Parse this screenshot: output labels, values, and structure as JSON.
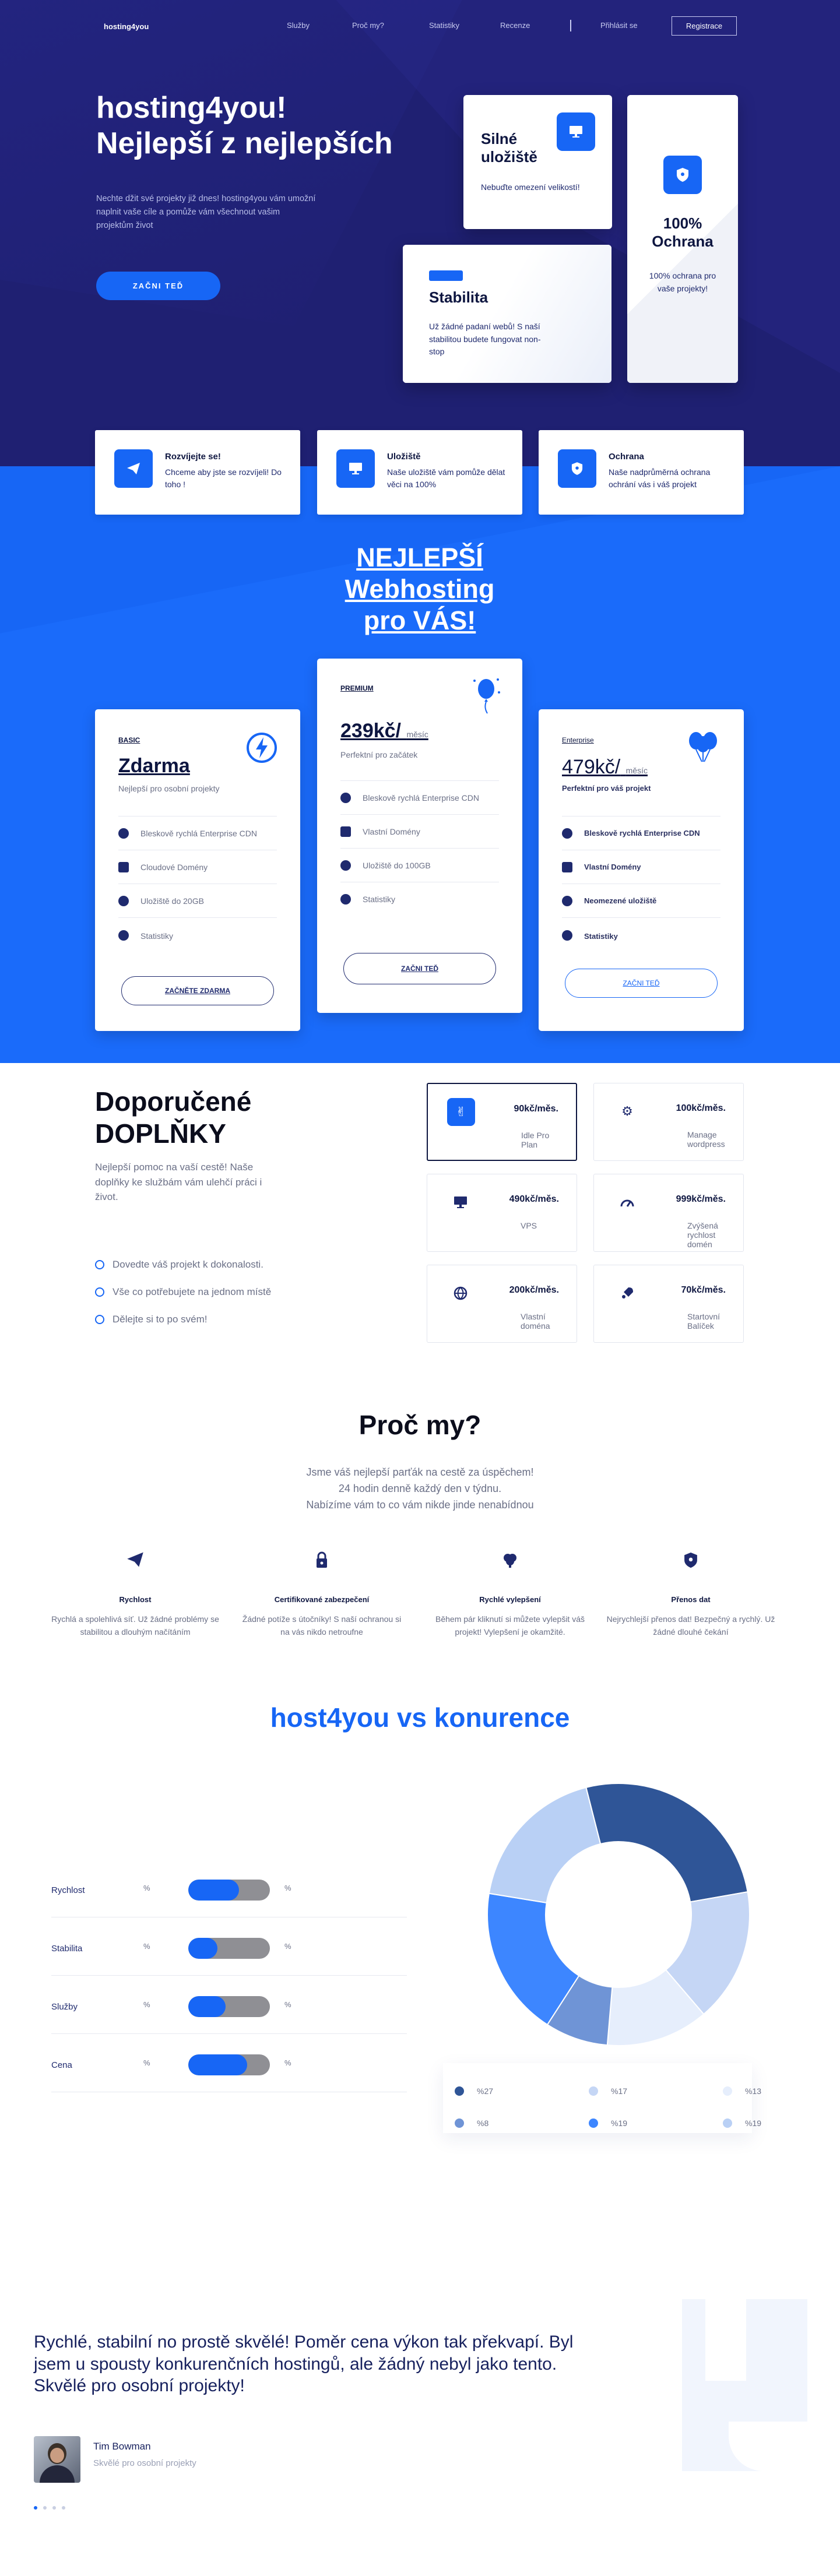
{
  "nav": {
    "logo": "hosting4you",
    "links": [
      "Služby",
      "Proč my?",
      "Statistiky",
      "Recenze"
    ],
    "login": "Přihlásit se",
    "register": "Registrace"
  },
  "hero": {
    "title_line1": "hosting4you!",
    "title_line2": "Nejlepší z nejlepších",
    "text": "Nechte džit své projekty již dnes! hosting4you vám umožní naplnit vaše cíle a pomůže vám všechnout vašim projektům život",
    "cta": "ZAČNI TEĎ",
    "cards": [
      {
        "title_line1": "Silné",
        "title_line2": "uložiště",
        "text": "Nebuďte omezení velikostí!",
        "icon": "monitor-icon"
      },
      {
        "title": "Stabilita",
        "text": "Už žádné padaní webů! S naší stabilitou budete fungovat non-stop"
      },
      {
        "title_line1": "100%",
        "title_line2": "Ochrana",
        "text": "100% ochrana pro vaše projekty!",
        "icon": "shield-icon"
      }
    ]
  },
  "features": [
    {
      "title": "Rozvíjejte se!",
      "text": "Chceme aby jste se rozvíjeli! Do toho !",
      "icon": "paper-plane-icon"
    },
    {
      "title": "Uložiště",
      "text": "Naše uložiště vám pomůže dělat věci na 100%",
      "icon": "monitor-icon"
    },
    {
      "title": "Ochrana",
      "text": "Naše nadprůměrná ochrana ochrání vás i váš projekt",
      "icon": "shield-icon"
    }
  ],
  "pricing": {
    "title_line1": "NEJLEPŠÍ",
    "title_line2": "Webhosting",
    "title_line3": "pro VÁS!",
    "plans": [
      {
        "label": "BASIC",
        "price": "Zdarma",
        "per": "",
        "desc": "Nejlepší pro osobní projekty",
        "features": [
          "Bleskově rychlá Enterprise CDN",
          "Cloudové Domény",
          "Uložiště do 20GB",
          "Statistiky"
        ],
        "button": "ZAČNĚTE ZDARMA"
      },
      {
        "label": "PREMIUM",
        "price": "239kč/",
        "per": "měsíc",
        "desc": "Perfektní pro začátek",
        "features": [
          "Bleskově rychlá Enterprise CDN",
          "Vlastní Domény",
          "Uložiště do 100GB",
          "Statistiky"
        ],
        "button": "ZAČNI TEĎ"
      },
      {
        "label": "Enterprise",
        "price": "479kč/",
        "per": "měsíc",
        "desc": "Perfektní pro váš projekt",
        "features": [
          "Bleskově rychlá Enterprise CDN",
          "Vlastní Domény",
          "Neomezené uložiště",
          "Statistiky"
        ],
        "button": "ZAČNI TEĎ"
      }
    ]
  },
  "addons": {
    "title_line1": "Doporučené",
    "title_line2": "DOPLŇKY",
    "text": "Nejlepší pomoc na vaší cestě! Naše doplňky ke službám vám ulehčí práci i život.",
    "checks": [
      "Dovedte váš projekt k dokonalosti.",
      "Vše co potřebujete na jednom místě",
      "Dělejte si to po svém!"
    ],
    "items": [
      {
        "price": "90kč/měs.",
        "name": "Idle Pro Plan",
        "icon": "handshake-icon"
      },
      {
        "price": "100kč/měs.",
        "name": "Manage wordpress",
        "icon": "gear-icon"
      },
      {
        "price": "490kč/měs.",
        "name": "VPS",
        "icon": "monitor-icon"
      },
      {
        "price": "999kč/měs.",
        "name": "Zvýšená rychlost domén",
        "icon": "speedometer-icon"
      },
      {
        "price": "200kč/měs.",
        "name": "Vlastní doména",
        "icon": "globe-icon"
      },
      {
        "price": "70kč/měs.",
        "name": "Startovní Balíček",
        "icon": "rocket-icon"
      }
    ]
  },
  "why": {
    "title": "Proč my?",
    "text_line1": "Jsme váš nejlepší parťák na cestě za úspěchem!",
    "text_line2": "24 hodin denně každý den v týdnu.",
    "text_line3": "Nabízíme vám to co vám nikde jinde nenabídnou",
    "items": [
      {
        "title": "Rychlost",
        "text": "Rychlá a spolehlivá síť. Už žádné problémy se stabilitou a dlouhým načítáním",
        "icon": "paper-plane-icon"
      },
      {
        "title": "Certifikované zabezpečení",
        "text": "Žádné potíže s útočníky! S naší ochranou si na vás nikdo netroufne",
        "icon": "lock-icon"
      },
      {
        "title": "Rychlé vylepšení",
        "text": "Během pár kliknutí si můžete vylepšit váš projekt! Vylepšení je okamžité.",
        "icon": "brain-icon"
      },
      {
        "title": "Přenos dat",
        "text": "Nejrychlejší přenos dat! Bezpečný a rychlý. Už žádné dlouhé čekání",
        "icon": "shield-icon"
      }
    ]
  },
  "compare": {
    "title": "host4you vs konurence",
    "bars": [
      {
        "label": "Rychlost",
        "left": "%",
        "right": "%",
        "fill": 0.62
      },
      {
        "label": "Stabilita",
        "left": "%",
        "right": "%",
        "fill": 0.36
      },
      {
        "label": "Služby",
        "left": "%",
        "right": "%",
        "fill": 0.46
      },
      {
        "label": "Cena",
        "left": "%",
        "right": "%",
        "fill": 0.72
      }
    ]
  },
  "chart_data": {
    "type": "pie",
    "slices": [
      {
        "label": "%27",
        "value": 27,
        "color": "#2f5597"
      },
      {
        "label": "%17",
        "value": 17,
        "color": "#c5d6f5"
      },
      {
        "label": "%13",
        "value": 13,
        "color": "#e6eefc"
      },
      {
        "label": "%8",
        "value": 8,
        "color": "#6f94d6"
      },
      {
        "label": "%19",
        "value": 19,
        "color": "#3d86ff"
      },
      {
        "label": "%19",
        "value": 19,
        "color": "#b9d0f5"
      }
    ]
  },
  "testimonial": {
    "quote": "Rychlé, stabilní no prostě skvělé! Poměr cena výkon tak překvapí. Byl jsem u spousty konkurenčních hostingů, ale žádný nebyl jako tento. Skvělé pro osobní projekty!",
    "name": "Tim Bowman",
    "role": "Skvělé pro osobní projekty"
  }
}
